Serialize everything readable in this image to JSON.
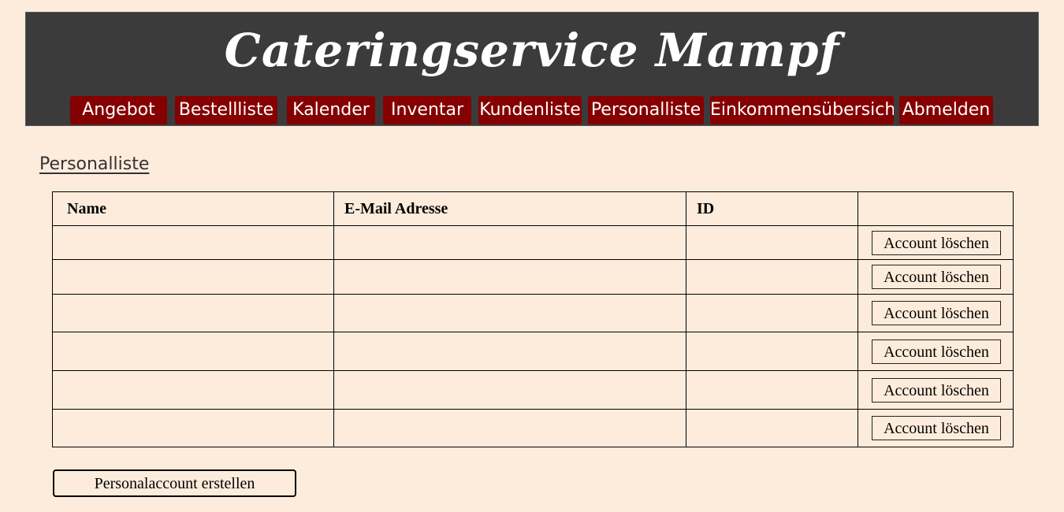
{
  "header": {
    "title": "Cateringservice Mampf",
    "nav": [
      {
        "label": "Angebot",
        "name": "nav-angebot"
      },
      {
        "label": "Bestellliste",
        "name": "nav-bestellliste"
      },
      {
        "label": "Kalender",
        "name": "nav-kalender"
      },
      {
        "label": "Inventar",
        "name": "nav-inventar"
      },
      {
        "label": "Kundenliste",
        "name": "nav-kundenliste"
      },
      {
        "label": "Personalliste",
        "name": "nav-personalliste"
      },
      {
        "label": "Einkommensübersicht",
        "name": "nav-einkommensuebersicht"
      },
      {
        "label": "Abmelden",
        "name": "nav-abmelden"
      }
    ]
  },
  "main": {
    "heading": "Personalliste",
    "table": {
      "columns": [
        "Name",
        "E-Mail Adresse",
        "ID",
        ""
      ],
      "rows": [
        {
          "name": "",
          "email": "",
          "id": "",
          "action": "Account löschen"
        },
        {
          "name": "",
          "email": "",
          "id": "",
          "action": "Account löschen"
        },
        {
          "name": "",
          "email": "",
          "id": "",
          "action": "Account löschen"
        },
        {
          "name": "",
          "email": "",
          "id": "",
          "action": "Account löschen"
        },
        {
          "name": "",
          "email": "",
          "id": "",
          "action": "Account löschen"
        },
        {
          "name": "",
          "email": "",
          "id": "",
          "action": "Account löschen"
        }
      ]
    },
    "create_button": "Personalaccount erstellen"
  },
  "colors": {
    "background": "#fdecdc",
    "header_bg": "#3b3b3b",
    "nav_bg": "#850000",
    "nav_text": "#ffffff"
  }
}
